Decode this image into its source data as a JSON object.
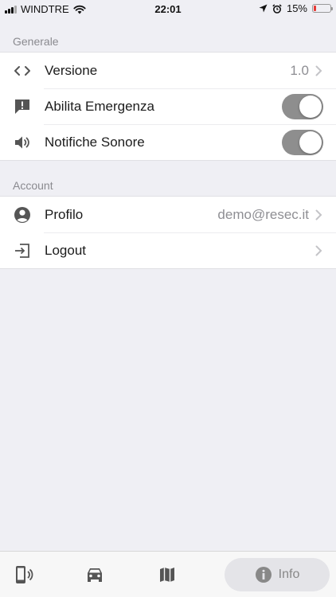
{
  "status_bar": {
    "carrier": "WINDTRE",
    "time": "22:01",
    "battery_percent": "15%",
    "battery_level": 0.15,
    "icons": [
      "signal-icon",
      "wifi-icon",
      "location-arrow-icon",
      "alarm-icon",
      "battery-icon"
    ]
  },
  "sections": {
    "general": {
      "header": "Generale",
      "rows": {
        "version": {
          "label": "Versione",
          "value": "1.0",
          "icon": "code-brackets-icon"
        },
        "emergency": {
          "label": "Abilita Emergenza",
          "icon": "alert-message-icon",
          "toggle_on": true
        },
        "sound": {
          "label": "Notifiche Sonore",
          "icon": "speaker-icon",
          "toggle_on": true
        }
      }
    },
    "account": {
      "header": "Account",
      "rows": {
        "profile": {
          "label": "Profilo",
          "value": "demo@resec.it",
          "icon": "user-circle-icon"
        },
        "logout": {
          "label": "Logout",
          "icon": "sign-in-icon"
        }
      }
    }
  },
  "tab_bar": {
    "tabs": [
      {
        "icon": "phone-signal-icon"
      },
      {
        "icon": "car-icon"
      },
      {
        "icon": "map-icon"
      },
      {
        "icon": "info-circle-icon",
        "label": "Info",
        "active": true
      }
    ]
  },
  "colors": {
    "background": "#efeff4",
    "toggle_on": "#8e8e8e",
    "secondary_text": "#8e8e93",
    "battery_low": "#e53935"
  }
}
